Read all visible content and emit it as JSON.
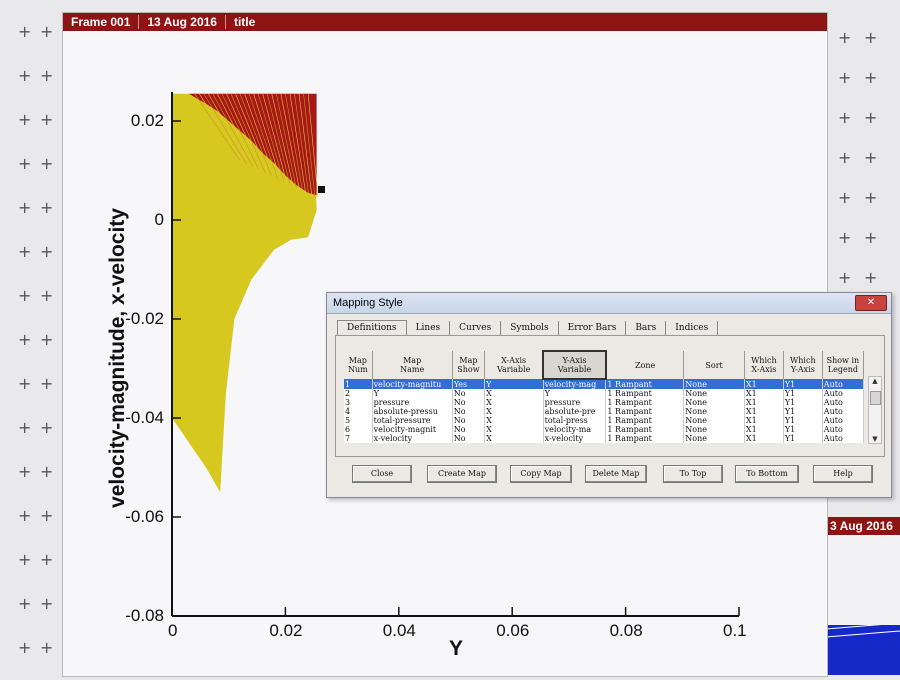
{
  "frame": {
    "header": [
      "Frame 001",
      "13 Aug 2016",
      "title"
    ]
  },
  "side_frame": {
    "header": "3 Aug 2016"
  },
  "workspace": {
    "grid_marker": "+"
  },
  "chart_data": {
    "type": "area",
    "xlabel": "Y",
    "ylabel": "velocity-magnitude, x-velocity",
    "xlim": [
      0,
      0.1
    ],
    "ylim": [
      -0.08,
      0.025
    ],
    "x_ticks": [
      "0",
      "0.02",
      "0.04",
      "0.06",
      "0.08",
      "0.1"
    ],
    "y_ticks": [
      "0.02",
      "0",
      "-0.02",
      "-0.04",
      "-0.06",
      "-0.08"
    ],
    "x_tick_values": [
      0,
      0.02,
      0.04,
      0.06,
      0.08,
      0.1
    ],
    "y_tick_values": [
      0.02,
      0,
      -0.02,
      -0.04,
      -0.06,
      -0.08
    ],
    "series": [
      {
        "color": "#d7c820",
        "x": [
          0,
          0.003,
          0.006,
          0.009,
          0.012,
          0.015,
          0.018,
          0.021,
          0.0235,
          0.025,
          0.0255,
          0.024,
          0.021,
          0.018,
          0.014,
          0.011,
          0.0095,
          0.009,
          0.0085,
          0.006,
          0.003,
          0
        ],
        "y": [
          0.0255,
          0.0255,
          0.0255,
          0.0255,
          0.0255,
          0.0255,
          0.0255,
          0.0255,
          0.0255,
          0.0255,
          0.002,
          -0.0035,
          -0.004,
          -0.006,
          -0.012,
          -0.02,
          -0.035,
          -0.045,
          -0.055,
          -0.05,
          -0.045,
          -0.04
        ]
      },
      {
        "color": "#a81818",
        "x": [
          0.003,
          0.0255,
          0.0255,
          0.024,
          0.022,
          0.02,
          0.018,
          0.016,
          0.014,
          0.012,
          0.01,
          0.009,
          0.008,
          0.006,
          0.004
        ],
        "y": [
          0.0255,
          0.0255,
          0.005,
          0.0055,
          0.007,
          0.009,
          0.0115,
          0.0135,
          0.016,
          0.018,
          0.02,
          0.021,
          0.022,
          0.0235,
          0.0248
        ]
      }
    ]
  },
  "dialog": {
    "title": "Mapping Style",
    "close_icon": "close-icon",
    "tabs": [
      "Definitions",
      "Lines",
      "Curves",
      "Symbols",
      "Error Bars",
      "Bars",
      "Indices"
    ],
    "active_tab": 0,
    "columns": [
      "Map\nNum",
      "Map\nName",
      "Map\nShow",
      "X-Axis\nVariable",
      "Y-Axis\nVariable",
      "Zone",
      "Sort",
      "Which\nX-Axis",
      "Which\nY-Axis",
      "Show in\nLegend"
    ],
    "rows": [
      [
        "1",
        "velocity-magnitu",
        "Yes",
        "Y",
        "velocity-mag",
        "1 Rampant",
        "None",
        "X1",
        "Y1",
        "Auto"
      ],
      [
        "2",
        "Y",
        "No",
        "X",
        "Y",
        "1 Rampant",
        "None",
        "X1",
        "Y1",
        "Auto"
      ],
      [
        "3",
        "pressure",
        "No",
        "X",
        "pressure",
        "1 Rampant",
        "None",
        "X1",
        "Y1",
        "Auto"
      ],
      [
        "4",
        "absolute-pressu",
        "No",
        "X",
        "absolute-pre",
        "1 Rampant",
        "None",
        "X1",
        "Y1",
        "Auto"
      ],
      [
        "5",
        "total-pressure",
        "No",
        "X",
        "total-press",
        "1 Rampant",
        "None",
        "X1",
        "Y1",
        "Auto"
      ],
      [
        "6",
        "velocity-magnit",
        "No",
        "X",
        "velocity-ma",
        "1 Rampant",
        "None",
        "X1",
        "Y1",
        "Auto"
      ],
      [
        "7",
        "x-velocity",
        "No",
        "X",
        "x-velocity",
        "1 Rampant",
        "None",
        "X1",
        "Y1",
        "Auto"
      ]
    ],
    "buttons": [
      "Close",
      "Create Map",
      "Copy Map",
      "Delete Map",
      "To Top",
      "To Bottom",
      "Help"
    ]
  }
}
